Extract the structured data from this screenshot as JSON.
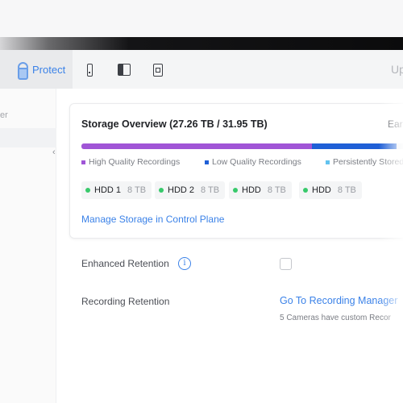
{
  "header": {
    "protect_label": "Protect",
    "icons": [
      "device-phone-icon",
      "split-view-icon",
      "doorbell-icon"
    ],
    "right_text": "Up"
  },
  "sidebar": {
    "partial_item": "er",
    "collapse_glyph": "‹"
  },
  "storage": {
    "title": "Storage Overview (27.26 TB / 31.95 TB)",
    "right_text": "Ear",
    "usage": {
      "high_quality_fraction": 0.68,
      "low_quality_fraction": 0.25,
      "colors": {
        "high_quality": "#a055d6",
        "low_quality": "#1f5fd6",
        "persistent": "#62c3ef",
        "track": "#eceef1"
      }
    },
    "legend": [
      {
        "label": "High Quality Recordings",
        "color": "#a055d6"
      },
      {
        "label": "Low Quality Recordings",
        "color": "#1f5fd6"
      },
      {
        "label": "Persistently Stored",
        "color": "#62c3ef"
      }
    ],
    "drives": [
      {
        "name": "HDD 1",
        "size": "8 TB",
        "status_color": "#38c96b"
      },
      {
        "name": "HDD 2",
        "size": "8 TB",
        "status_color": "#38c96b"
      },
      {
        "name": "HDD",
        "size": "8 TB",
        "status_color": "#38c96b"
      },
      {
        "name": "HDD",
        "size": "8 TB",
        "status_color": "#38c96b"
      }
    ],
    "manage_link": "Manage Storage in Control Plane"
  },
  "enhanced_retention": {
    "label": "Enhanced Retention",
    "info_glyph": "i",
    "checked": false
  },
  "recording_retention": {
    "label": "Recording Retention",
    "link": "Go To Recording Manager",
    "note": "5 Cameras have custom Recor"
  }
}
